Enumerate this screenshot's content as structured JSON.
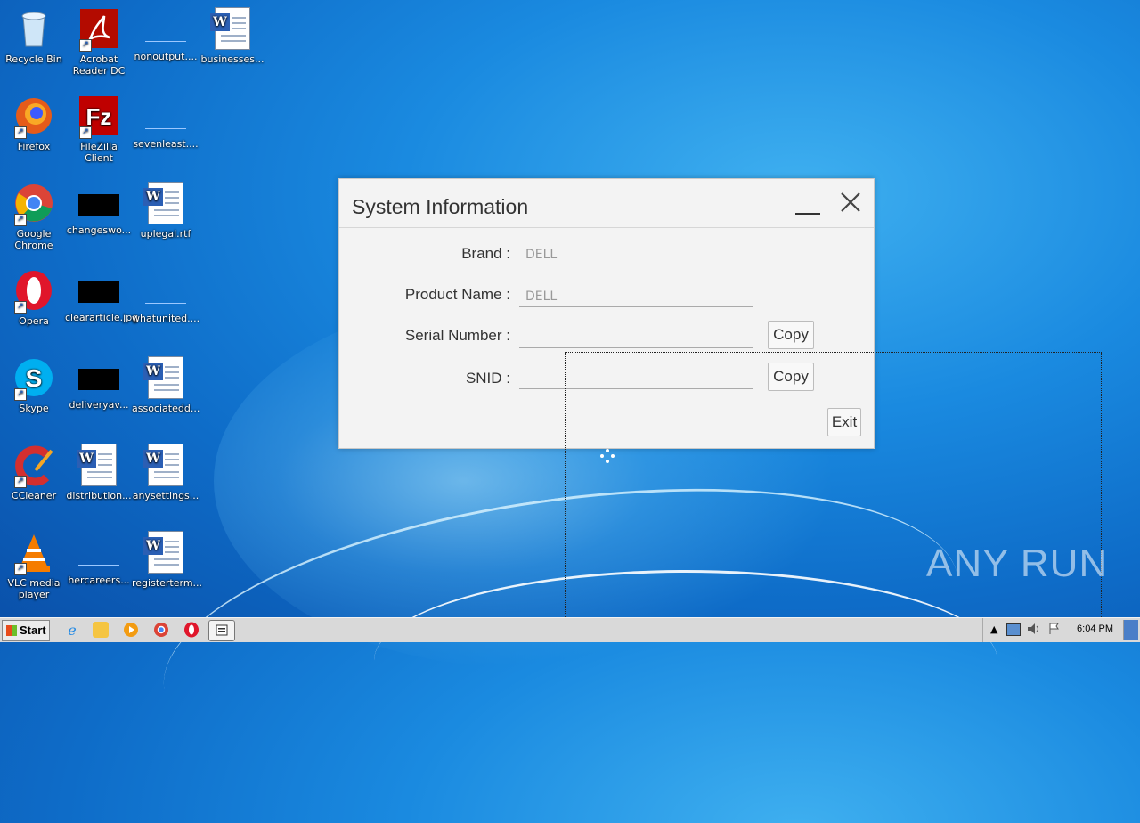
{
  "desktop": {
    "icons": [
      {
        "label": "Recycle Bin",
        "icon": "recycle-bin-icon"
      },
      {
        "label": "Acrobat Reader DC",
        "icon": "acrobat-icon"
      },
      {
        "label": "nonoutput....",
        "icon": "file-icon"
      },
      {
        "label": "businesses...",
        "icon": "word-doc-icon"
      },
      {
        "label": "Firefox",
        "icon": "firefox-icon"
      },
      {
        "label": "FileZilla Client",
        "icon": "filezilla-icon"
      },
      {
        "label": "sevenleast....",
        "icon": "file-icon"
      },
      {
        "label": "Google Chrome",
        "icon": "chrome-icon"
      },
      {
        "label": "changeswo...",
        "icon": "image-file-icon"
      },
      {
        "label": "uplegal.rtf",
        "icon": "word-doc-icon"
      },
      {
        "label": "Opera",
        "icon": "opera-icon"
      },
      {
        "label": "cleararticle.jpg",
        "icon": "image-file-icon"
      },
      {
        "label": "whatunited....",
        "icon": "file-icon"
      },
      {
        "label": "Skype",
        "icon": "skype-icon"
      },
      {
        "label": "deliveryav...",
        "icon": "image-file-icon"
      },
      {
        "label": "associatedd...",
        "icon": "word-doc-icon"
      },
      {
        "label": "CCleaner",
        "icon": "ccleaner-icon"
      },
      {
        "label": "distribution...",
        "icon": "word-doc-icon"
      },
      {
        "label": "anysettings...",
        "icon": "word-doc-icon"
      },
      {
        "label": "VLC media player",
        "icon": "vlc-icon"
      },
      {
        "label": "hercareers...",
        "icon": "file-icon"
      },
      {
        "label": "registerterm...",
        "icon": "word-doc-icon"
      }
    ]
  },
  "dialog": {
    "title": "System Information",
    "fields": [
      {
        "label": "Brand :",
        "value": "DELL"
      },
      {
        "label": "Product Name :",
        "value": "DELL"
      },
      {
        "label": "Serial Number :",
        "value": ""
      },
      {
        "label": "SNID :",
        "value": ""
      }
    ],
    "copy_label": "Copy",
    "exit_label": "Exit"
  },
  "watermark": "ANY RUN",
  "taskbar": {
    "start_label": "Start",
    "clock": "6:04 PM"
  }
}
